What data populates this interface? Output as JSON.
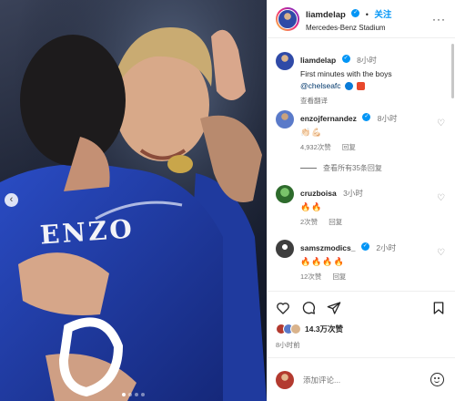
{
  "post": {
    "author": "liamdelap",
    "follow_label": "关注",
    "separator": "•",
    "location": "Mercedes-Benz Stadium",
    "more_icon": "more-horizontal-icon",
    "caption": {
      "user": "liamdelap",
      "time": "8小时",
      "text": "First minutes with the boys",
      "mention": "@chelseafc",
      "flag_colors": [
        "#0a7bd8",
        "#e8482c"
      ],
      "translate": "查看翻译"
    }
  },
  "comments": [
    {
      "user": "enzojfernandez",
      "verified": true,
      "time": "8小时",
      "emoji": "👏🏻💪🏻",
      "likes": "4,932次赞",
      "reply": "回复"
    },
    {
      "user": "cruzboisa",
      "verified": false,
      "time": "3小时",
      "emoji": "🔥🔥",
      "likes": "2次赞",
      "reply": "回复"
    },
    {
      "user": "samszmodics_",
      "verified": true,
      "time": "2小时",
      "emoji": "🔥🔥🔥🔥",
      "likes": "12次赞",
      "reply": "回复"
    }
  ],
  "view_replies": "查看所有35条回复",
  "actions": {
    "like_icon": "heart-icon",
    "comment_icon": "comment-icon",
    "share_icon": "share-icon",
    "save_icon": "bookmark-icon"
  },
  "likes_count": "14.3万次赞",
  "post_time": "8小时前",
  "add_comment": {
    "placeholder": "添加评论..."
  },
  "jersey_text": "ENZO",
  "carousel": {
    "current": 1,
    "total": 4
  },
  "colors": {
    "accent": "#0095f6",
    "chelsea_blue": "#1b3ea8"
  }
}
